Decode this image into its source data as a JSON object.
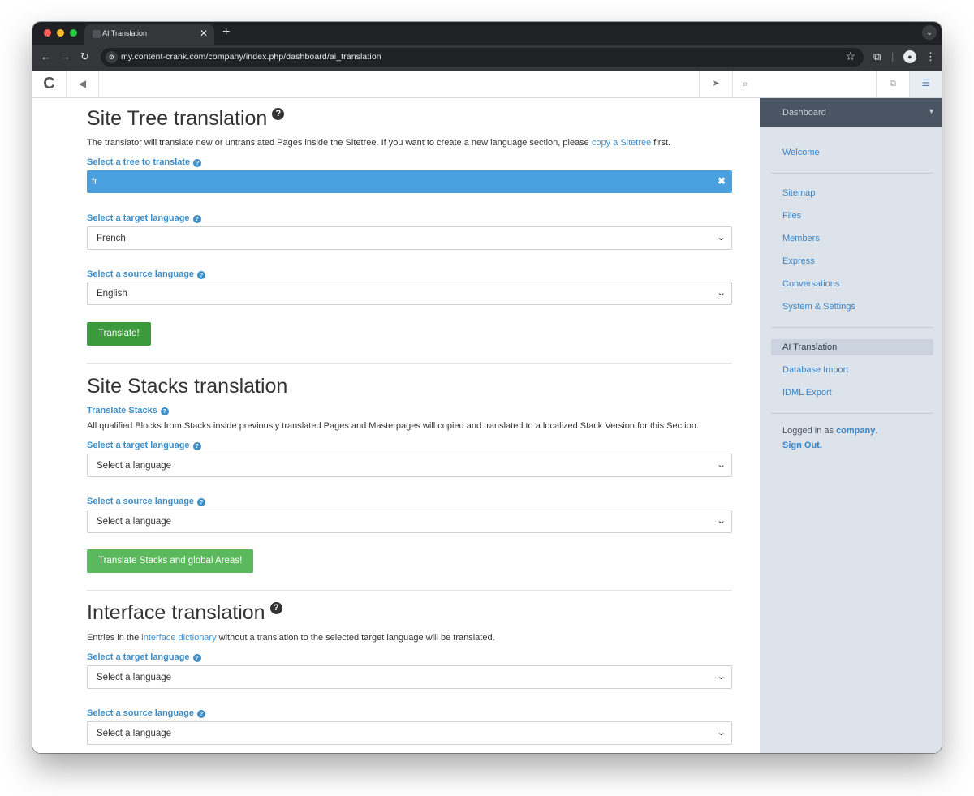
{
  "browser": {
    "tab_title": "AI Translation",
    "tab_close": "✕",
    "new_tab": "+",
    "url": "my.content-crank.com/company/index.php/dashboard/ai_translation"
  },
  "cms_toolbar": {
    "search_placeholder": ""
  },
  "site_tree": {
    "title": "Site Tree translation",
    "desc_before": "The translator will translate new or untranslated Pages inside the Sitetree. If you want to create a new language section, please ",
    "desc_link": "copy a Sitetree",
    "desc_after": " first.",
    "tree_label": "Select a tree to translate",
    "tree_value": "fr",
    "target_label": "Select a target language",
    "target_value": "French",
    "source_label": "Select a source language",
    "source_value": "English",
    "button": "Translate!"
  },
  "site_stacks": {
    "title": "Site Stacks translation",
    "stacks_label": "Translate Stacks",
    "desc": "All qualified Blocks from Stacks inside previously translated Pages and Masterpages will copied and translated to a localized Stack Version for this Section.",
    "target_label": "Select a target language",
    "target_value": "Select a language",
    "source_label": "Select a source language",
    "source_value": "Select a language",
    "button": "Translate Stacks and global Areas!"
  },
  "interface": {
    "title": "Interface translation",
    "desc_before": "Entries in the ",
    "desc_link": "interface dictionary",
    "desc_after": " without a translation to the selected target language will be translated.",
    "target_label": "Select a target language",
    "target_value": "Select a language",
    "source_label": "Select a source language",
    "source_value": "Select a language"
  },
  "sidebar": {
    "header": "Dashboard",
    "welcome": "Welcome",
    "items": [
      "Sitemap",
      "Files",
      "Members",
      "Express",
      "Conversations",
      "System & Settings"
    ],
    "active": "AI Translation",
    "extra": [
      "Database Import",
      "IDML Export"
    ],
    "logged_in_prefix": "Logged in as ",
    "user": "company",
    "logged_in_suffix": ".",
    "sign_out": "Sign Out."
  }
}
